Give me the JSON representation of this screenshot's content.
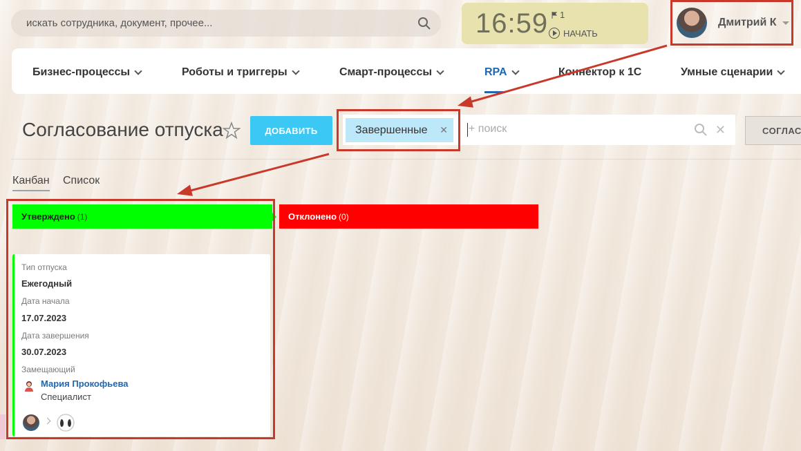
{
  "search": {
    "placeholder": "искать сотрудника, документ, прочее..."
  },
  "clock": {
    "time": "16:59",
    "flag_count": "1",
    "start_label": "НАЧАТЬ"
  },
  "user": {
    "name": "Дмитрий К"
  },
  "nav": {
    "items": [
      {
        "label": "Бизнес-процессы",
        "has_dropdown": true
      },
      {
        "label": "Роботы и триггеры",
        "has_dropdown": true
      },
      {
        "label": "Смарт-процессы",
        "has_dropdown": true
      },
      {
        "label": "RPA",
        "has_dropdown": true,
        "active": true
      },
      {
        "label": "Коннектор к 1С",
        "has_dropdown": false
      },
      {
        "label": "Умные сценарии",
        "has_dropdown": true
      }
    ]
  },
  "page": {
    "title": "Согласование отпуска",
    "add_button": "ДОБАВИТЬ",
    "filter_chip": "Завершенные",
    "filter_placeholder": "+ поиск",
    "right_button": "СОГЛАСОВАНИЕ"
  },
  "views": {
    "kanban": "Канбан",
    "list": "Список"
  },
  "columns": [
    {
      "title": "Утверждено",
      "count": "(1)",
      "color": "#00ff00"
    },
    {
      "title": "Отклонено",
      "count": "(0)",
      "color": "#ff0000"
    }
  ],
  "card": {
    "vacation_type_label": "Тип отпуска",
    "vacation_type_value": "Ежегодный",
    "start_label": "Дата начала",
    "start_value": "17.07.2023",
    "end_label": "Дата завершения",
    "end_value": "30.07.2023",
    "deputy_label": "Замещающий",
    "deputy_name": "Мария Прокофьева",
    "deputy_role": "Специалист"
  },
  "colors": {
    "accent": "#3bc8f5",
    "link": "#2067b0",
    "annotation": "#c9392b"
  }
}
